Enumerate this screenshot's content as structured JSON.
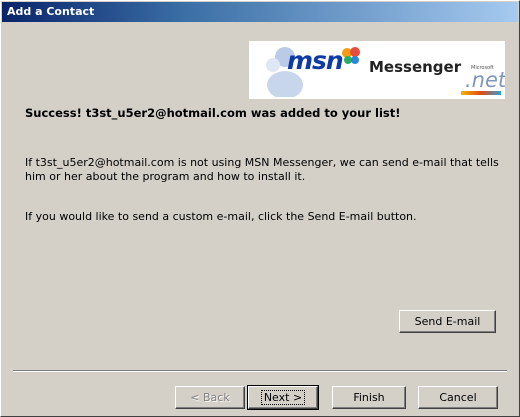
{
  "window": {
    "title": "Add a Contact"
  },
  "logo": {
    "brand": "msn",
    "product": "Messenger",
    "ms_small": "Microsoft",
    "net": ".net"
  },
  "content": {
    "success": "Success! t3st_u5er2@hotmail.com was added to your list!",
    "para1": "If t3st_u5er2@hotmail.com is not using MSN Messenger, we can send e-mail that tells him or her about the program and how to install it.",
    "para2": "If you would like to send a custom e-mail, click the Send E-mail button."
  },
  "buttons": {
    "send_email": "Send E-mail",
    "back": "< Back",
    "next": "Next >",
    "finish": "Finish",
    "cancel": "Cancel"
  }
}
